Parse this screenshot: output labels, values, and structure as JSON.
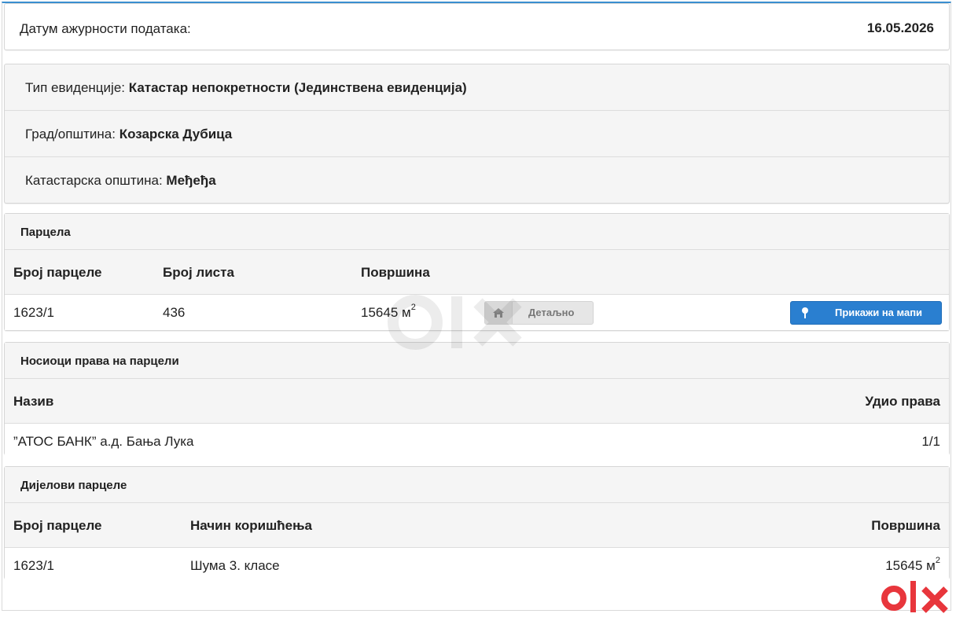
{
  "date": {
    "label": "Датум ажурности података:",
    "value": "16.05.2026"
  },
  "info": {
    "type_label": "Тип евиденције:",
    "type_value": "Катастар непокретности (Јединствена евиденција)",
    "city_label": "Град/општина:",
    "city_value": "Козарска Дубица",
    "cadastral_label": "Катастарска општина:",
    "cadastral_value": "Међеђа"
  },
  "parcela": {
    "title": "Парцела",
    "headers": [
      "Број парцеле",
      "Број листа",
      "Површина"
    ],
    "row": {
      "number": "1623/1",
      "sheet": "436",
      "area": "15645 м",
      "area_sup": "2"
    },
    "detail_button": "Детаљно",
    "map_button": "Прикажи на мапи"
  },
  "nosioci": {
    "title": "Носиоци права на парцели",
    "headers": [
      "Назив",
      "Удио права"
    ],
    "row": {
      "name": "”АТОС БАНК” а.д. Бања Лука",
      "share": "1/1"
    }
  },
  "dijelovi": {
    "title": "Дијелови парцеле",
    "headers": [
      "Број парцеле",
      "Начин коришћења",
      "Површина"
    ],
    "row": {
      "number": "1623/1",
      "usage": "Шума 3. класе",
      "area": "15645 м",
      "area_sup": "2"
    }
  },
  "icons": {
    "home": "home-icon",
    "pin": "map-pin-icon",
    "logo": "olx-logo"
  },
  "colors": {
    "accent": "#2a7fd0",
    "logo": "#e8363c"
  }
}
